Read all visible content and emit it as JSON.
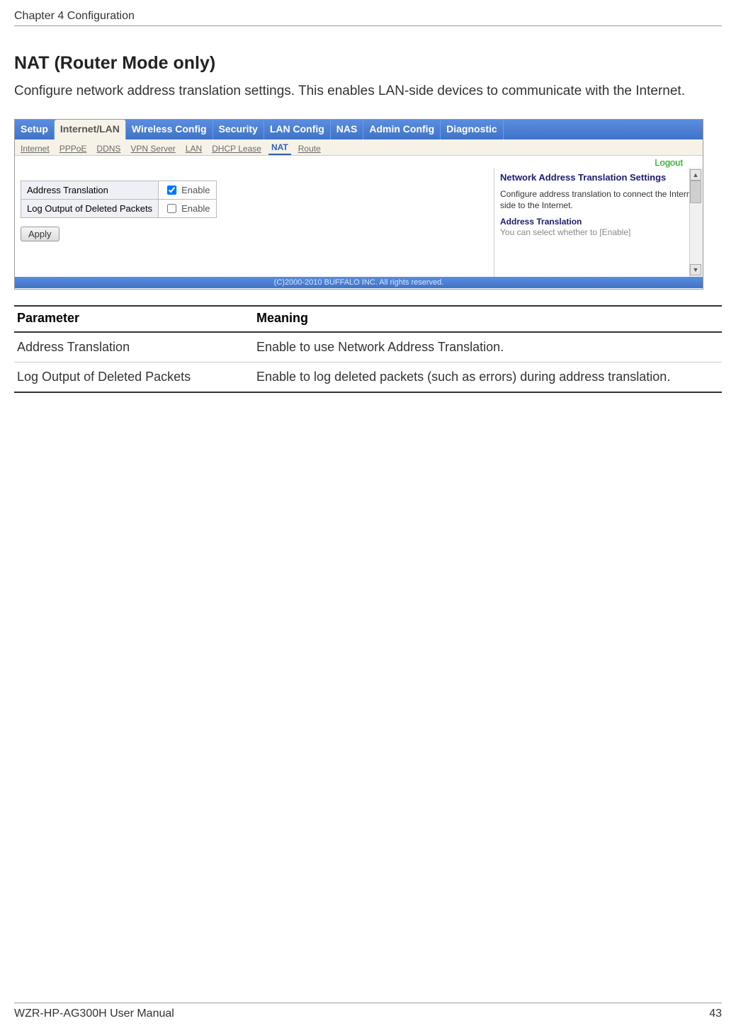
{
  "header": {
    "chapter": "Chapter 4  Configuration"
  },
  "section": {
    "title": "NAT (Router Mode only)",
    "intro": "Configure network address translation settings. This enables LAN-side devices to communicate with the Internet."
  },
  "router_ui": {
    "main_tabs": [
      "Setup",
      "Internet/LAN",
      "Wireless Config",
      "Security",
      "LAN Config",
      "NAS",
      "Admin Config",
      "Diagnostic"
    ],
    "active_main_tab_index": 1,
    "sub_tabs": [
      "Internet",
      "PPPoE",
      "DDNS",
      "VPN Server",
      "LAN",
      "DHCP Lease",
      "NAT",
      "Route"
    ],
    "active_sub_tab_index": 6,
    "logout_label": "Logout",
    "settings": {
      "rows": [
        {
          "label": "Address Translation",
          "checkbox_label": "Enable",
          "checked": true
        },
        {
          "label": "Log Output of Deleted Packets",
          "checkbox_label": "Enable",
          "checked": false
        }
      ]
    },
    "apply_label": "Apply",
    "help": {
      "title": "Network Address Translation Settings",
      "body": "Configure address translation to connect the Internet side to the Internet.",
      "subheading": "Address Translation",
      "trailing": "You can select whether to [Enable]"
    },
    "copyright": "(C)2000-2010 BUFFALO INC. All rights reserved."
  },
  "param_table": {
    "headers": [
      "Parameter",
      "Meaning"
    ],
    "rows": [
      {
        "param": "Address Translation",
        "meaning": "Enable to use Network Address Translation."
      },
      {
        "param": "Log Output of Deleted Packets",
        "meaning": "Enable to log deleted packets (such as errors) during address translation."
      }
    ]
  },
  "footer": {
    "manual": "WZR-HP-AG300H User Manual",
    "page": "43"
  }
}
